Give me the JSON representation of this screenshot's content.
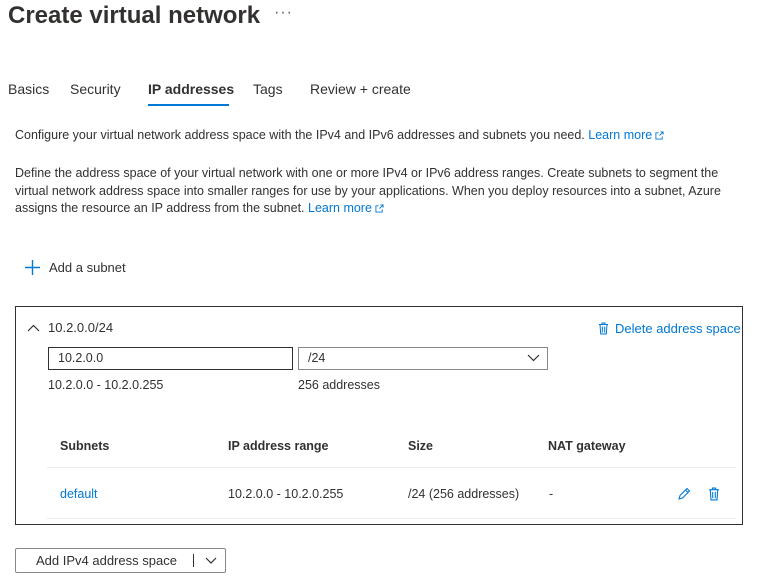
{
  "page": {
    "title": "Create virtual network",
    "more_label": "···"
  },
  "tabs": [
    {
      "label": "Basics",
      "active": false
    },
    {
      "label": "Security",
      "active": false
    },
    {
      "label": "IP addresses",
      "active": true
    },
    {
      "label": "Tags",
      "active": false
    },
    {
      "label": "Review + create",
      "active": false
    }
  ],
  "intro": {
    "text1": "Configure your virtual network address space with the IPv4 and IPv6 addresses and subnets you need.",
    "link1": "Learn more",
    "text2": "Define the address space of your virtual network with one or more IPv4 or IPv6 address ranges. Create subnets to segment the virtual network address space into smaller ranges for use by your applications. When you deploy resources into a subnet, Azure assigns the resource an IP address from the subnet.",
    "link2": "Learn more"
  },
  "add_subnet_label": "Add a subnet",
  "address_space": {
    "title": "10.2.0.0/24",
    "delete_label": "Delete address space",
    "address_value": "10.2.0.0",
    "prefix_value": "/24",
    "range_text": "10.2.0.0 - 10.2.0.255",
    "count_text": "256 addresses"
  },
  "subnets_table": {
    "headers": [
      "Subnets",
      "IP address range",
      "Size",
      "NAT gateway"
    ],
    "rows": [
      {
        "name": "default",
        "range": "10.2.0.0 - 10.2.0.255",
        "size": "/24 (256 addresses)",
        "nat": "-"
      }
    ]
  },
  "add_ipv4_label": "Add IPv4 address space",
  "colors": {
    "accent": "#0078d4",
    "text": "#323130"
  }
}
